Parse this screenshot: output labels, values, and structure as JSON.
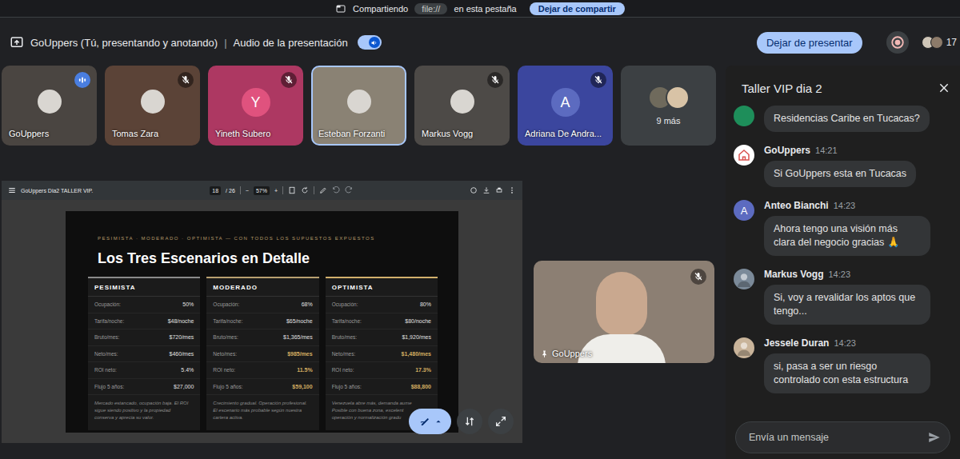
{
  "banner": {
    "prefix": "Compartiendo",
    "chip": "file://",
    "suffix": "en esta pestaña",
    "button": "Dejar de compartir"
  },
  "bar": {
    "label": "GoUppers (Tú, presentando y anotando)",
    "separator": "|",
    "audio_label": "Audio de la presentación",
    "audio_on": true,
    "stop_button": "Dejar de presentar",
    "participant_count": "17"
  },
  "tiles": [
    {
      "name": "GoUppers",
      "kind": "video",
      "muted": false,
      "speaking": true,
      "highlighted": false,
      "color": "#4a4541"
    },
    {
      "name": "Tomas Zara",
      "kind": "video",
      "muted": true,
      "speaking": false,
      "highlighted": false,
      "color": "#5b4337"
    },
    {
      "name": "Yineth Subero",
      "kind": "avatar",
      "letter": "Y",
      "muted": true,
      "speaking": false,
      "highlighted": false,
      "color": "#ad3862",
      "avatar_color": "#e0527e"
    },
    {
      "name": "Esteban Forzanti",
      "kind": "video",
      "muted": false,
      "speaking": false,
      "highlighted": true,
      "color": "#8a8274"
    },
    {
      "name": "Markus Vogg",
      "kind": "video",
      "muted": true,
      "speaking": false,
      "highlighted": false,
      "color": "#4d4a47"
    },
    {
      "name": "Adriana De Andra...",
      "kind": "avatar",
      "letter": "A",
      "muted": true,
      "speaking": false,
      "highlighted": false,
      "color": "#3b469e",
      "avatar_color": "#5c6bc0"
    }
  ],
  "more_tile": {
    "label": "9 más"
  },
  "viewer": {
    "filename": "GoUppers Dia2 TALLER VIP.",
    "page": "18",
    "total": "/ 26",
    "zoom_out": "−",
    "zoom": "57%",
    "zoom_in": "+"
  },
  "slide": {
    "eyebrow": "PESIMISTA · MODERADO · OPTIMISTA — CON TODOS LOS SUPUESTOS EXPUESTOS",
    "title": "Los Tres Escenarios en Detalle",
    "columns": [
      {
        "name": "PESIMISTA",
        "color": "#8a8a8a",
        "rows": [
          {
            "label": "Ocupación:",
            "value": "50%",
            "highlight": false
          },
          {
            "label": "Tarifa/noche:",
            "value": "$48/noche",
            "highlight": false
          },
          {
            "label": "Bruto/mes:",
            "value": "$720/mes",
            "highlight": false
          },
          {
            "label": "Neto/mes:",
            "value": "$460/mes",
            "highlight": false
          },
          {
            "label": "ROI neto:",
            "value": "5.4%",
            "highlight": false
          },
          {
            "label": "Flujo 5 años:",
            "value": "$27,000",
            "highlight": false
          }
        ],
        "desc_lines": [
          "Mercado estancado, ocupación baja. El ROI",
          "sigue siendo positivo y la propiedad",
          "conserva y aprecia su valor."
        ]
      },
      {
        "name": "MODERADO",
        "color": "#b8a071",
        "rows": [
          {
            "label": "Ocupación:",
            "value": "68%",
            "highlight": false
          },
          {
            "label": "Tarifa/noche:",
            "value": "$65/noche",
            "highlight": false
          },
          {
            "label": "Bruto/mes:",
            "value": "$1,365/mes",
            "highlight": false
          },
          {
            "label": "Neto/mes:",
            "value": "$985/mes",
            "highlight": true
          },
          {
            "label": "ROI neto:",
            "value": "11.5%",
            "highlight": true
          },
          {
            "label": "Flujo 5 años:",
            "value": "$59,100",
            "highlight": true
          }
        ],
        "desc_lines": [
          "Crecimiento gradual. Operación profesional.",
          "El escenario más probable según nuestra",
          "cartera activa."
        ]
      },
      {
        "name": "OPTIMISTA",
        "color": "#d2b06c",
        "rows": [
          {
            "label": "Ocupación:",
            "value": "80%",
            "highlight": false
          },
          {
            "label": "Tarifa/noche:",
            "value": "$80/noche",
            "highlight": false
          },
          {
            "label": "Bruto/mes:",
            "value": "$1,920/mes",
            "highlight": false
          },
          {
            "label": "Neto/mes:",
            "value": "$1,480/mes",
            "highlight": true
          },
          {
            "label": "ROI neto:",
            "value": "17.3%",
            "highlight": true
          },
          {
            "label": "Flujo 5 años:",
            "value": "$88,800",
            "highlight": true
          }
        ],
        "desc_lines": [
          "Venezuela abre más, demanda aume",
          "Posible con buena zona, excelent",
          "operación y normalización gradu"
        ]
      }
    ]
  },
  "self_view": {
    "name": "GoUppers",
    "muted": true
  },
  "chat": {
    "title": "Taller VIP dia 2",
    "messages": [
      {
        "kind": "continued",
        "text": "Residencias Caribe en Tucacas?",
        "color": "#1e8e5a"
      },
      {
        "kind": "logo",
        "sender": "GoUppers",
        "time": "14:21",
        "text": "Si GoUppers esta en Tucacas",
        "color": "#ffffff"
      },
      {
        "kind": "letter",
        "letter": "A",
        "sender": "Anteo Bianchi",
        "time": "14:23",
        "text": "Ahora tengo una visión más clara del negocio gracias 🙏",
        "color": "#5c6bc0"
      },
      {
        "kind": "photo",
        "sender": "Markus Vogg",
        "time": "14:23",
        "text": "Si, voy a revalidar los aptos que tengo...",
        "color": "#7b8a99"
      },
      {
        "kind": "photo",
        "sender": "Jessele Duran",
        "time": "14:23",
        "text": "si, pasa a ser un riesgo controlado con esta estructura",
        "color": "#c9b49a"
      }
    ],
    "placeholder": "Envía un mensaje"
  }
}
